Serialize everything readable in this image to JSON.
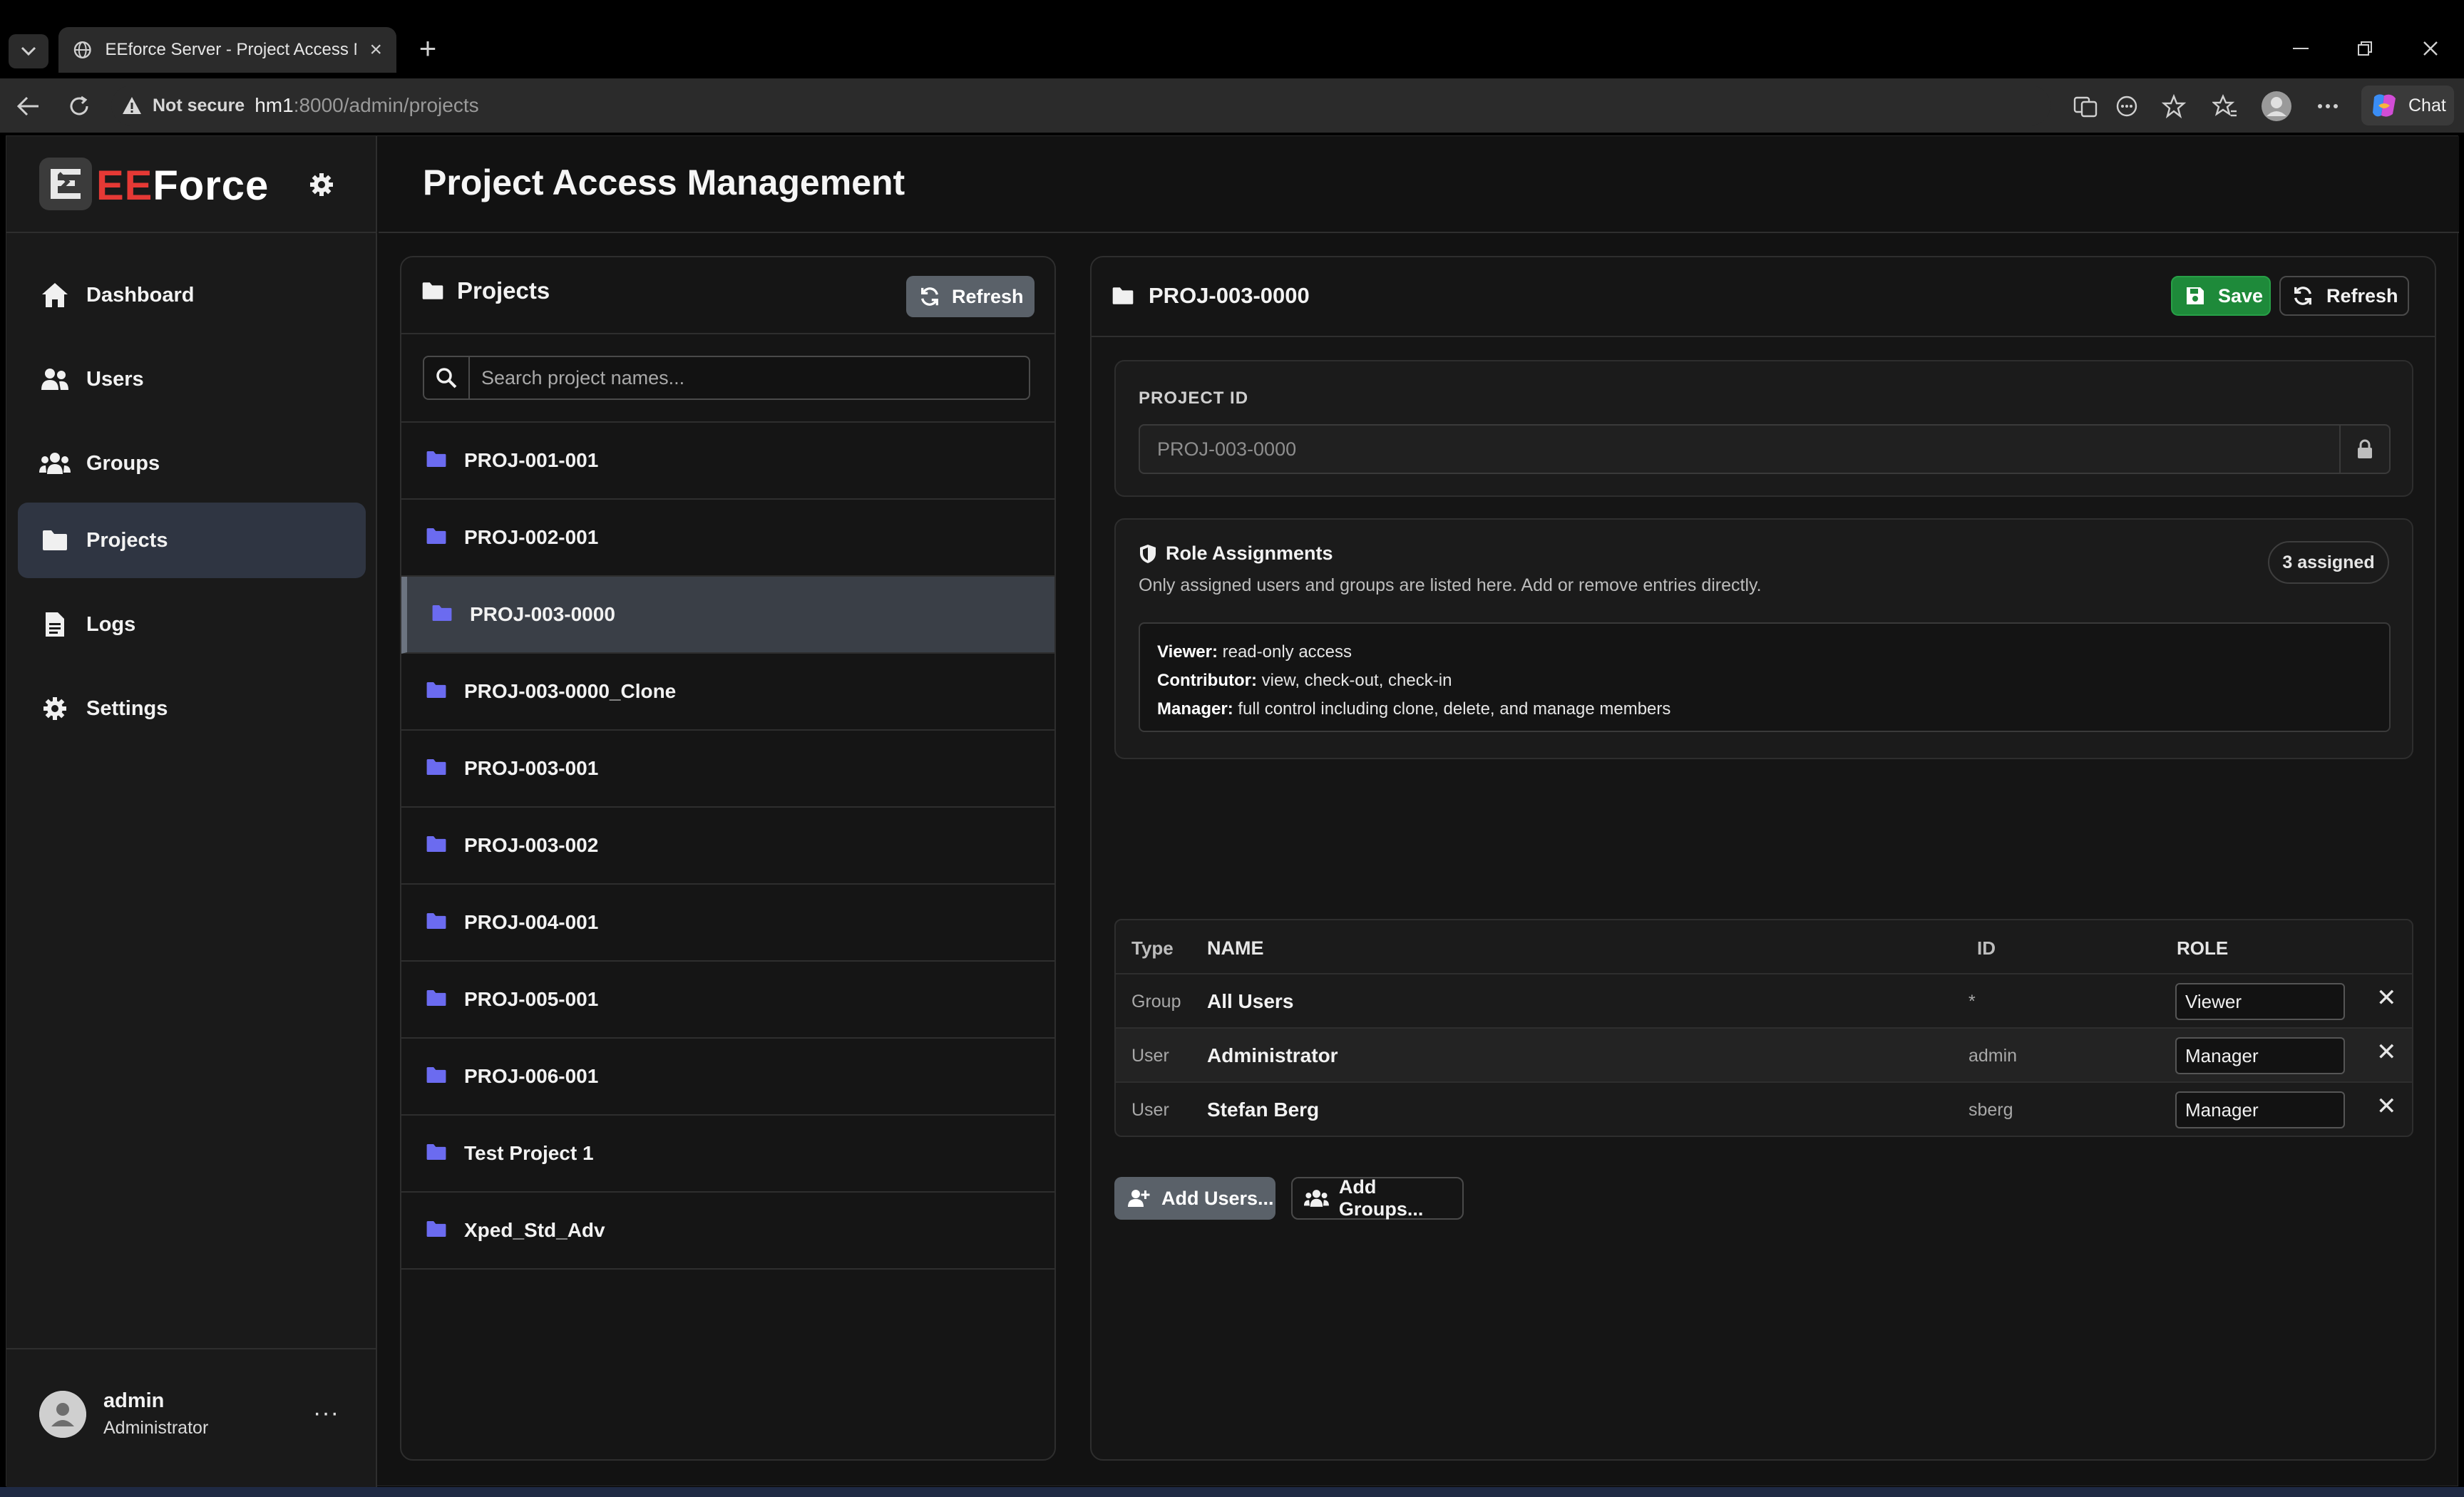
{
  "browser": {
    "tab_title": "EEforce Server - Project Access Ma",
    "security_label": "Not secure",
    "url_host": "hm1",
    "url_path": ":8000/admin/projects",
    "chat_label": "Chat"
  },
  "brand": {
    "name_red": "EE",
    "name_white": "Force"
  },
  "page_title": "Project Access Management",
  "sidebar": {
    "items": [
      {
        "label": "Dashboard",
        "icon": "home-icon"
      },
      {
        "label": "Users",
        "icon": "users-icon"
      },
      {
        "label": "Groups",
        "icon": "groups-icon"
      },
      {
        "label": "Projects",
        "icon": "folder-icon",
        "active": true
      },
      {
        "label": "Logs",
        "icon": "file-icon"
      },
      {
        "label": "Settings",
        "icon": "gear-icon"
      }
    ],
    "user": {
      "name": "admin",
      "role": "Administrator",
      "more": "···"
    }
  },
  "projects_panel": {
    "title": "Projects",
    "refresh_label": "Refresh",
    "search_placeholder": "Search project names...",
    "items": [
      "PROJ-001-001",
      "PROJ-002-001",
      "PROJ-003-0000",
      "PROJ-003-0000_Clone",
      "PROJ-003-001",
      "PROJ-003-002",
      "PROJ-004-001",
      "PROJ-005-001",
      "PROJ-006-001",
      "Test Project 1",
      "Xped_Std_Adv"
    ],
    "selected": "PROJ-003-0000"
  },
  "detail": {
    "title": "PROJ-003-0000",
    "save_label": "Save",
    "refresh_label": "Refresh",
    "project_id_label": "PROJECT ID",
    "project_id_value": "PROJ-003-0000",
    "role_assignments": {
      "title": "Role Assignments",
      "description": "Only assigned users and groups are listed here. Add or remove entries directly.",
      "badge": "3 assigned",
      "roles": [
        {
          "name": "Viewer:",
          "desc": " read-only access"
        },
        {
          "name": "Contributor:",
          "desc": " view, check-out, check-in"
        },
        {
          "name": "Manager:",
          "desc": " full control including clone, delete, and manage members"
        }
      ]
    },
    "table": {
      "headers": {
        "type": "Type",
        "name": "NAME",
        "id": "ID",
        "role": "ROLE"
      },
      "rows": [
        {
          "type": "Group",
          "name": "All Users",
          "id": "*",
          "role": "Viewer"
        },
        {
          "type": "User",
          "name": "Administrator",
          "id": "admin",
          "role": "Manager"
        },
        {
          "type": "User",
          "name": "Stefan Berg",
          "id": "sberg",
          "role": "Manager"
        }
      ],
      "remove_symbol": "✕"
    },
    "add_users_label": "Add Users...",
    "add_groups_label": "Add Groups..."
  },
  "colors": {
    "accent_folder": "#6b6bf0",
    "save_green": "#1e8a3a",
    "brand_red": "#e53935",
    "active_nav": "#2f3542"
  }
}
